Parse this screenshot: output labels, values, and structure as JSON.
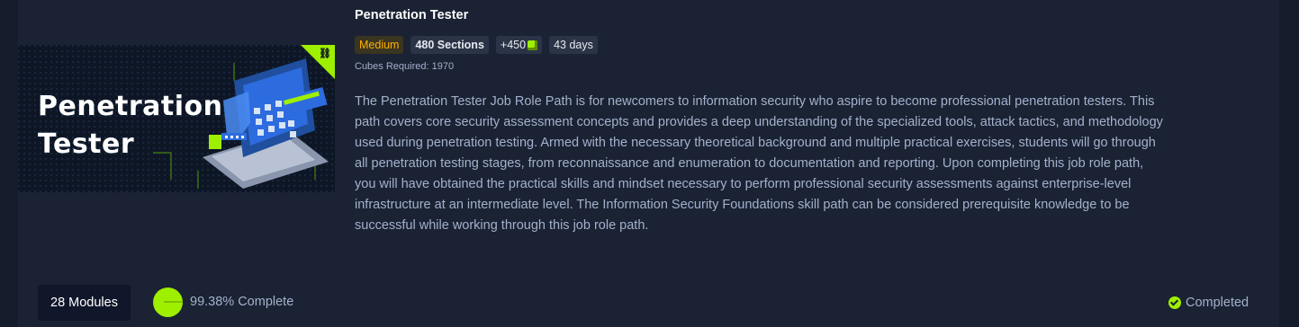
{
  "path": {
    "title": "Penetration Tester",
    "thumbnail_title_line1": "Penetration",
    "thumbnail_title_line2": "Tester",
    "badges": {
      "difficulty": "Medium",
      "sections": "480 Sections",
      "cubes": "+450",
      "days": "43 days"
    },
    "cubes_required": "Cubes Required: 1970",
    "description": "The Penetration Tester Job Role Path is for newcomers to information security who aspire to become professional penetration testers. This path covers core security assessment concepts and provides a deep understanding of the specialized tools, attack tactics, and methodology used during penetration testing. Armed with the necessary theoretical background and multiple practical exercises, students will go through all penetration testing stages, from reconnaissance and enumeration to documentation and reporting. Upon completing this job role path, you will have obtained the practical skills and mindset necessary to perform professional security assessments against enterprise-level infrastructure at an intermediate level. The Information Security Foundations skill path can be considered prerequisite knowledge to be successful while working through this job role path."
  },
  "footer": {
    "modules": "28 Modules",
    "progress_text": "99.38% Complete",
    "progress_value": 0.9938,
    "status": "Completed"
  },
  "colors": {
    "accent": "#9fef00",
    "difficulty_medium": "#ffaf00",
    "background": "#1a2233"
  },
  "icons": {
    "corner": "path-icon",
    "cube": "cube-icon",
    "status": "check-circle-icon"
  }
}
